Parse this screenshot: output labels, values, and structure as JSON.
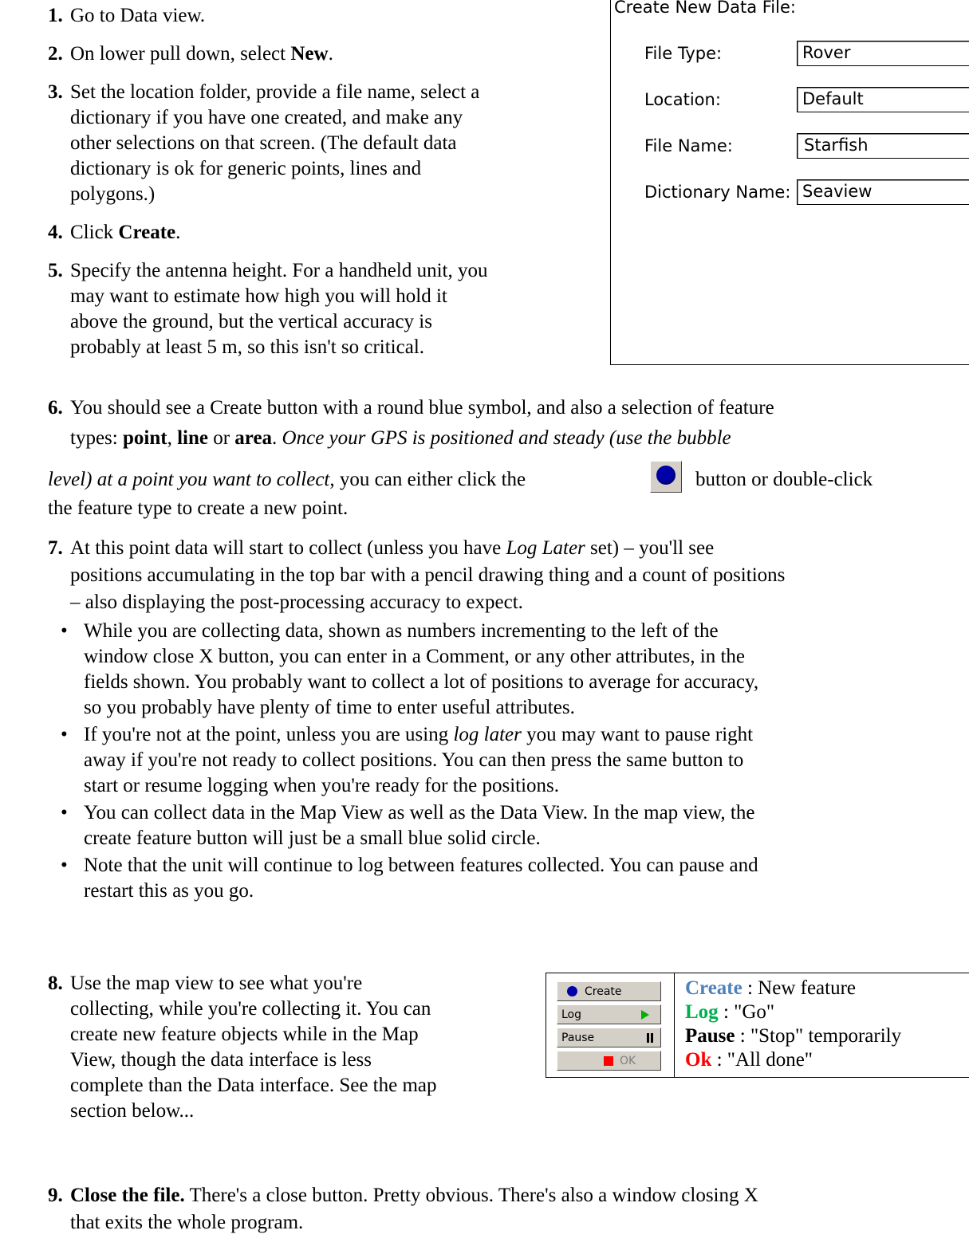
{
  "steps": {
    "s1": {
      "num": "1.",
      "text": "Go to Data view."
    },
    "s2": {
      "num": "2.",
      "pre": "On lower pull down, select ",
      "bold": "New",
      "post": "."
    },
    "s3": {
      "num": "3.",
      "lines": [
        "Set the location folder, provide a file name, select a",
        "dictionary if you have one created, and make any",
        "other selections on that screen.  (The default data",
        "dictionary is ok for generic points, lines and",
        "polygons.)"
      ]
    },
    "s4": {
      "num": "4.",
      "pre": "Click ",
      "bold": "Create",
      "post": "."
    },
    "s5": {
      "num": "5.",
      "lines": [
        "Specify the antenna height.  For a handheld unit, you",
        "may want to estimate how high you will hold it",
        "above the ground, but the vertical accuracy is",
        "probably at least 5 m, so this isn't so critical."
      ]
    },
    "s6": {
      "num": "6.",
      "l1": "You should see a Create button with a round blue symbol, and also a selection of feature",
      "l2_pre": "types:  ",
      "point": "point",
      "comma": ", ",
      "line": "line",
      "or": " or ",
      "area": "area",
      "dot": ".  ",
      "l2_italic": "Once your GPS is positioned and steady (use the bubble",
      "l3_italic": "level) at a point you want to collect,",
      "l3_post": " you can either click the",
      "l3_after": "button or double-click",
      "l4": "the feature type to create a new point."
    },
    "s7": {
      "num": "7.",
      "l1_pre": "At this point data will start to collect (unless you have ",
      "l1_italic": "Log Later",
      "l1_post": " set) – you'll see",
      "l2": "positions accumulating in the top bar with a pencil drawing thing and a count of positions",
      "l3": "– also displaying the post-processing accuracy to expect.",
      "bullets": [
        {
          "lines": [
            "While you are collecting data, shown as numbers incrementing to the left of the",
            "window close X button, you can enter in a Comment, or any other attributes, in the",
            "fields shown.  You probably want to collect a lot of positions to average for accuracy,",
            "so you probably have plenty of time to enter useful attributes."
          ]
        },
        {
          "pre": " If you're not at the point, unless you are using ",
          "italic": "log later",
          "post": " you may want to pause right",
          "lines": [
            "away if you're not ready to collect positions.  You can then press the same button to",
            "start or resume logging when you're ready for the positions."
          ]
        },
        {
          "lines": [
            "You can collect data in the Map View as well as the Data View.  In the map view, the",
            "create feature button will just be a small blue solid circle."
          ]
        },
        {
          "lines": [
            "Note that the unit will continue to log between features collected.  You can pause and",
            "restart this as you go."
          ]
        }
      ]
    },
    "s8": {
      "num": "8.",
      "lines": [
        "Use the map view to see what you're",
        "collecting, while you're collecting it.  You can",
        "create new feature objects while in the Map",
        "View, though the data interface is less",
        "complete than the Data interface.  See the map",
        "section below..."
      ]
    },
    "s9": {
      "num": "9.",
      "bold": "Close the file.",
      "post": "  There's a close button.  Pretty obvious.  There's also a window closing X",
      "l2": "that exits the whole program."
    }
  },
  "dialog": {
    "title": "Create New Data File:",
    "file_type_label": "File Type:",
    "file_type_value": "Rover",
    "location_label": "Location:",
    "location_value": "Default",
    "file_name_label": "File Name:",
    "file_name_value": "Starfish",
    "dictionary_label": "Dictionary Name:",
    "dictionary_value": "Seaview"
  },
  "legend": {
    "create_btn": "Create",
    "log_btn": "Log",
    "pause_btn": "Pause",
    "ok_btn": "OK",
    "create_term": "Create",
    "create_desc": " : New feature",
    "log_term": "Log",
    "log_desc": " : \"Go\"",
    "pause_term": "Pause",
    "pause_desc": " : \"Stop\" temporarily",
    "ok_term": "Ok",
    "ok_desc": " : \"All done\"",
    "colors": {
      "create": "#4f81bd",
      "log": "#00b050",
      "ok": "#ff0000",
      "dot": "#0000a8",
      "play": "#00b000"
    }
  }
}
